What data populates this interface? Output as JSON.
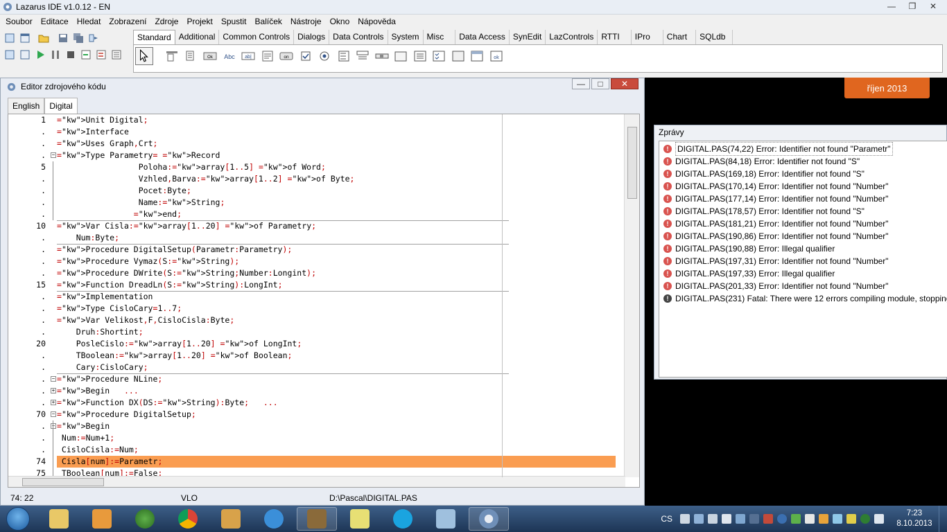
{
  "ide": {
    "title": "Lazarus IDE v1.0.12 - EN",
    "menu": [
      "Soubor",
      "Editace",
      "Hledat",
      "Zobrazení",
      "Zdroje",
      "Projekt",
      "Spustit",
      "Balíček",
      "Nástroje",
      "Okno",
      "Nápověda"
    ]
  },
  "palette": {
    "tabs": [
      "Standard",
      "Additional",
      "Common Controls",
      "Dialogs",
      "Data Controls",
      "System",
      "Misc",
      "Data Access",
      "SynEdit",
      "LazControls",
      "RTTI",
      "IPro",
      "Chart",
      "SQLdb"
    ],
    "active_tab": "Standard",
    "component_labels": [
      "Ok",
      "Abc",
      "ab|",
      "on"
    ]
  },
  "editor": {
    "title": "Editor zdrojového kódu",
    "tabs": [
      "English",
      "Digital"
    ],
    "active_tab": "Digital",
    "status": {
      "position": "74: 22",
      "mode": "VLO",
      "file": "D:\\Pascal\\DIGITAL.PAS"
    },
    "line_numbers": [
      "1",
      ".",
      ".",
      ".",
      "5",
      ".",
      ".",
      ".",
      ".",
      "10",
      ".",
      ".",
      ".",
      ".",
      "15",
      ".",
      ".",
      ".",
      ".",
      "20",
      ".",
      ".",
      ".",
      ".",
      ".",
      "70",
      ".",
      ".",
      ".",
      "74",
      "75"
    ],
    "lines": [
      "Unit Digital;",
      "Interface",
      "Uses Graph,Crt;",
      "Type Parametry= Record",
      "                 Poloha:array[1..5] of Word;",
      "                 Vzhled,Barva:array[1..2] of Byte;",
      "                 Pocet:Byte;",
      "                 Name:String;",
      "                end;",
      "Var Cisla:array[1..20] of Parametry;",
      "    Num:Byte;",
      "Procedure DigitalSetup(Parametr:Parametry);",
      "Procedure Vymaz(S:String);",
      "Procedure DWrite(S:String;Number:Longint);",
      "Function DreadLn(S:String):LongInt;",
      "Implementation",
      "Type CisloCary=1..7;",
      "Var Velikost,F,CisloCisla:Byte;",
      "    Druh:Shortint;",
      "    PosleCislo:array[1..20] of LongInt;",
      "    TBoolean:array[1..20] of Boolean;",
      "    Cary:CisloCary;",
      "Procedure NLine;",
      "Begin   ...",
      "Function DX(DS:String):Byte;   ...",
      "Procedure DigitalSetup;",
      "Begin",
      " Num:=Num+1;",
      " CisloCisla:=Num;",
      " Cisla[num]:=Parametr;",
      " TBoolean[num]:=False;"
    ]
  },
  "messages": {
    "title": "Zprávy",
    "items": [
      {
        "type": "error",
        "text": "DIGITAL.PAS(74,22) Error: Identifier not found \"Parametr\""
      },
      {
        "type": "error",
        "text": "DIGITAL.PAS(84,18) Error: Identifier not found \"S\""
      },
      {
        "type": "error",
        "text": "DIGITAL.PAS(169,18) Error: Identifier not found \"S\""
      },
      {
        "type": "error",
        "text": "DIGITAL.PAS(170,14) Error: Identifier not found \"Number\""
      },
      {
        "type": "error",
        "text": "DIGITAL.PAS(177,14) Error: Identifier not found \"Number\""
      },
      {
        "type": "error",
        "text": "DIGITAL.PAS(178,57) Error: Identifier not found \"S\""
      },
      {
        "type": "error",
        "text": "DIGITAL.PAS(181,21) Error: Identifier not found \"Number\""
      },
      {
        "type": "error",
        "text": "DIGITAL.PAS(190,86) Error: Identifier not found \"Number\""
      },
      {
        "type": "error",
        "text": "DIGITAL.PAS(190,88) Error: Illegal qualifier"
      },
      {
        "type": "error",
        "text": "DIGITAL.PAS(197,31) Error: Identifier not found \"Number\""
      },
      {
        "type": "error",
        "text": "DIGITAL.PAS(197,33) Error: Illegal qualifier"
      },
      {
        "type": "error",
        "text": "DIGITAL.PAS(201,33) Error: Identifier not found \"Number\""
      },
      {
        "type": "fatal",
        "text": "DIGITAL.PAS(231) Fatal: There were 12 errors compiling module, stopping"
      }
    ]
  },
  "desktop": {
    "date_label": "říjen 2013"
  },
  "taskbar": {
    "language": "CS",
    "time": "7:23",
    "date": "8.10.2013"
  },
  "colors": {
    "highlight_line": "#fa9d51",
    "accent_orange": "#e0661f",
    "error_red": "#d9534f"
  }
}
